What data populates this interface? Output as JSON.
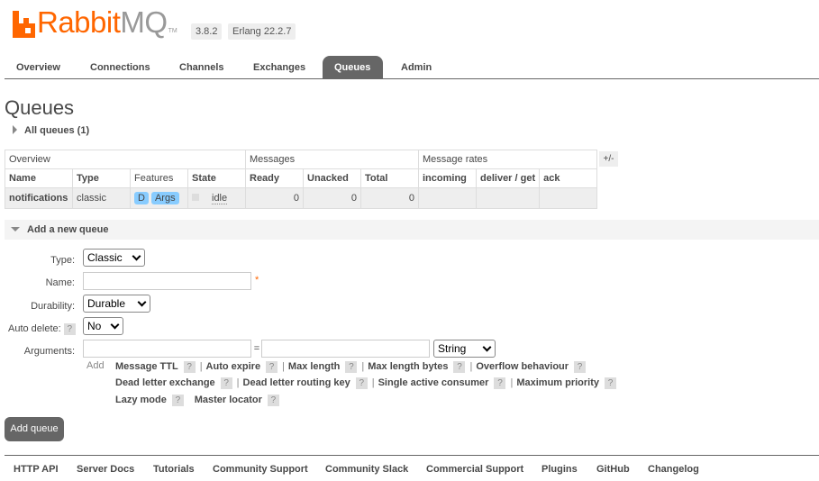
{
  "header": {
    "logo_rabbit": "Rabbit",
    "logo_mq": "MQ",
    "logo_tm": "TM",
    "version": "3.8.2",
    "erlang": "Erlang 22.2.7"
  },
  "tabs": [
    "Overview",
    "Connections",
    "Channels",
    "Exchanges",
    "Queues",
    "Admin"
  ],
  "active_tab": "Queues",
  "page_title": "Queues",
  "all_queues_label": "All queues (1)",
  "table": {
    "group_headers": [
      "Overview",
      "Messages",
      "Message rates"
    ],
    "columns": [
      "Name",
      "Type",
      "Features",
      "State",
      "Ready",
      "Unacked",
      "Total",
      "incoming",
      "deliver / get",
      "ack"
    ],
    "rows": [
      {
        "name": "notifications",
        "type": "classic",
        "features": [
          "D",
          "Args"
        ],
        "state": "idle",
        "ready": "0",
        "unacked": "0",
        "total": "0",
        "incoming": "",
        "deliver_get": "",
        "ack": ""
      }
    ],
    "plus_minus": "+/-"
  },
  "add_queue": {
    "section_label": "Add a new queue",
    "type_label": "Type:",
    "type_value": "Classic",
    "name_label": "Name:",
    "name_value": "",
    "required_star": "*",
    "durability_label": "Durability:",
    "durability_value": "Durable",
    "auto_delete_label": "Auto delete:",
    "auto_delete_help": "?",
    "auto_delete_value": "No",
    "arguments_label": "Arguments:",
    "arg_key_value": "",
    "equals": "=",
    "arg_value": "",
    "arg_type_value": "String",
    "add_label": "Add",
    "help_symbol": "?",
    "separator": "|",
    "arg_links_row1": [
      "Message TTL",
      "Auto expire",
      "Max length",
      "Max length bytes",
      "Overflow behaviour"
    ],
    "arg_links_row2": [
      "Dead letter exchange",
      "Dead letter routing key",
      "Single active consumer",
      "Maximum priority"
    ],
    "arg_links_row3": [
      "Lazy mode",
      "Master locator"
    ],
    "submit_label": "Add queue"
  },
  "footer": {
    "links": [
      "HTTP API",
      "Server Docs",
      "Tutorials",
      "Community Support",
      "Community Slack",
      "Commercial Support",
      "Plugins",
      "GitHub",
      "Changelog"
    ]
  },
  "colors": {
    "brand_orange": "#ff6600",
    "tab_active_bg": "#666666",
    "feature_pill": "#88ccff"
  }
}
